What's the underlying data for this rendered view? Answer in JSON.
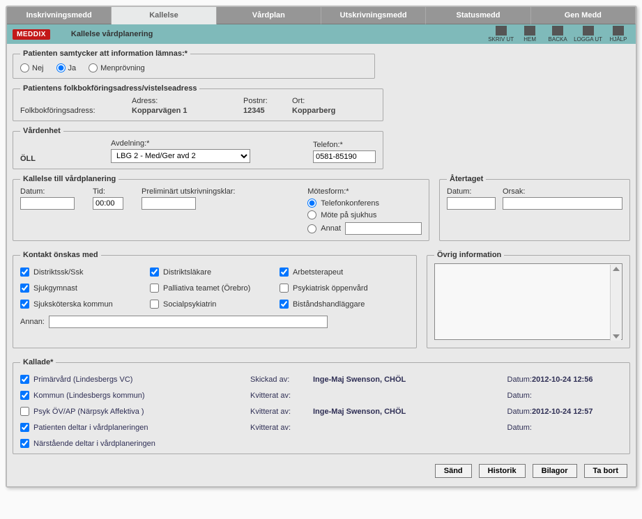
{
  "tabs": [
    "Inskrivningsmedd",
    "Kallelse",
    "Vårdplan",
    "Utskrivningsmedd",
    "Statusmedd",
    "Gen Medd"
  ],
  "active_tab": 1,
  "logo": "MEDDIX",
  "subtitle": "Kallelse vårdplanering",
  "tools": [
    "SKRIV UT",
    "HEM",
    "BACKA",
    "LOGGA UT",
    "HJÄLP"
  ],
  "consent": {
    "legend": "Patienten samtycker att information lämnas:*",
    "options": [
      "Nej",
      "Ja",
      "Menprövning"
    ],
    "selected": 1
  },
  "folk": {
    "legend": "Patientens folkbokföringsadress/vistelseadress",
    "h_adress": "Adress:",
    "h_postnr": "Postnr:",
    "h_ort": "Ort:",
    "rowlabel": "Folkbokföringsadress:",
    "adress": "Kopparvägen 1",
    "postnr": "12345",
    "ort": "Kopparberg"
  },
  "vardenhet": {
    "legend": "Vårdenhet",
    "enhet_lbl": "ÖLL",
    "avd_lbl": "Avdelning:*",
    "avd_val": "LBG 2 - Med/Ger avd 2",
    "tel_lbl": "Telefon:*",
    "tel_val": "0581-85190"
  },
  "kallelse": {
    "legend": "Kallelse till vårdplanering",
    "datum_lbl": "Datum:",
    "datum_val": "",
    "tid_lbl": "Tid:",
    "tid_val": "00:00",
    "prel_lbl": "Preliminärt utskrivningsklar:",
    "prel_val": "",
    "mf_lbl": "Mötesform:*",
    "mf_opts": [
      "Telefonkonferens",
      "Möte på sjukhus",
      "Annat"
    ],
    "mf_sel": 0,
    "annat_val": ""
  },
  "atertaget": {
    "legend": "Återtaget",
    "datum_lbl": "Datum:",
    "datum_val": "",
    "orsak_lbl": "Orsak:",
    "orsak_val": ""
  },
  "kontakt": {
    "legend": "Kontakt önskas med",
    "col1": [
      {
        "label": "Distriktssk/Ssk",
        "checked": true
      },
      {
        "label": "Sjukgymnast",
        "checked": true
      },
      {
        "label": "Sjuksköterska kommun",
        "checked": true
      }
    ],
    "col2": [
      {
        "label": "Distriktsläkare",
        "checked": true
      },
      {
        "label": "Palliativa teamet (Örebro)",
        "checked": false
      },
      {
        "label": "Socialpsykiatrin",
        "checked": false
      }
    ],
    "col3": [
      {
        "label": "Arbetsterapeut",
        "checked": true
      },
      {
        "label": "Psykiatrisk öppenvård",
        "checked": false
      },
      {
        "label": "Biståndshandläggare",
        "checked": true
      }
    ],
    "annan_lbl": "Annan:",
    "annan_val": ""
  },
  "ovrig": {
    "legend": "Övrig information",
    "val": ""
  },
  "kallade": {
    "legend": "Kallade*",
    "rows": [
      {
        "label": "Primärvård (Lindesbergs VC)",
        "checked": true,
        "kv_lbl": "Skickad av:",
        "kv_val": "Inge-Maj Swenson, CHÖL",
        "d_lbl": "Datum:",
        "d_val": "2012-10-24 12:56"
      },
      {
        "label": "Kommun (Lindesbergs kommun)",
        "checked": true,
        "kv_lbl": "Kvitterat av:",
        "kv_val": "",
        "d_lbl": "Datum:",
        "d_val": ""
      },
      {
        "label": "Psyk ÖV/AP (Närpsyk Affektiva )",
        "checked": false,
        "kv_lbl": "Kvitterat av:",
        "kv_val": "Inge-Maj Swenson, CHÖL",
        "d_lbl": "Datum:",
        "d_val": "2012-10-24 12:57"
      },
      {
        "label": "Patienten deltar i vårdplaneringen",
        "checked": true,
        "kv_lbl": "Kvitterat av:",
        "kv_val": "",
        "d_lbl": "Datum:",
        "d_val": ""
      },
      {
        "label": "Närstående deltar i vårdplaneringen",
        "checked": true,
        "kv_lbl": "",
        "kv_val": "",
        "d_lbl": "",
        "d_val": ""
      }
    ]
  },
  "footer": {
    "send": "Sänd",
    "historik": "Historik",
    "bilagor": "Bilagor",
    "tabort": "Ta bort"
  }
}
